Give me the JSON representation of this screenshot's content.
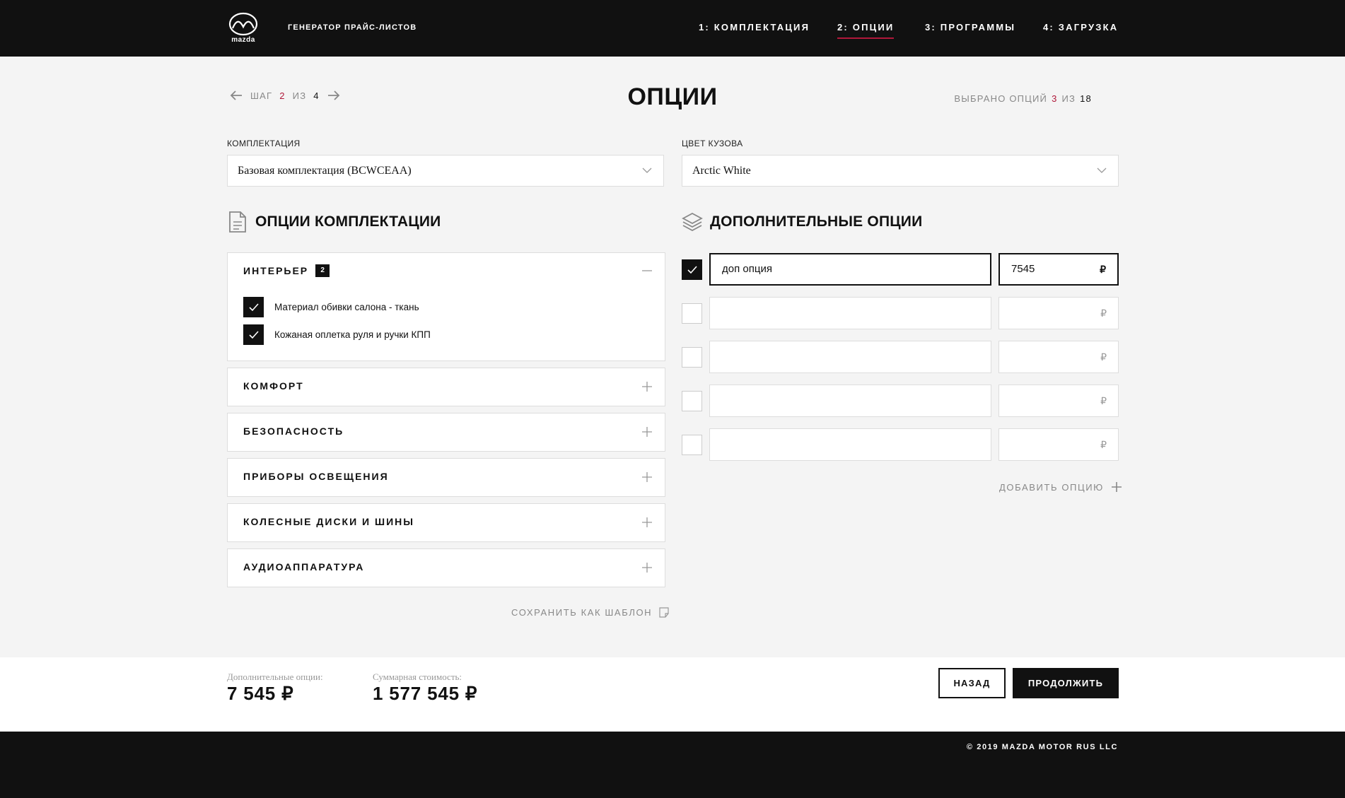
{
  "header": {
    "brand": "mazda",
    "app_title": "ГЕНЕРАТОР ПРАЙС-ЛИСТОВ",
    "nav": [
      {
        "label": "1: КОМПЛЕКТАЦИЯ"
      },
      {
        "label": "2: ОПЦИИ",
        "active": true
      },
      {
        "label": "3: ПРОГРАММЫ"
      },
      {
        "label": "4: ЗАГРУЗКА"
      }
    ]
  },
  "step": {
    "prefix": "ШАГ",
    "current": "2",
    "of": "ИЗ",
    "total": "4"
  },
  "page_title": "ОПЦИИ",
  "selected": {
    "prefix": "ВЫБРАНО ОПЦИЙ",
    "current": "3",
    "of": "ИЗ",
    "total": "18"
  },
  "trim": {
    "label": "КОМПЛЕКТАЦИЯ",
    "value": "Базовая комплектация (BCWCEAA)"
  },
  "color": {
    "label": "ЦВЕТ КУЗОВА",
    "value": "Arctic White"
  },
  "trim_options": {
    "title": "ОПЦИИ КОМПЛЕКТАЦИИ",
    "groups": [
      {
        "title": "ИНТЕРЬЕР",
        "count": "2",
        "expanded": true,
        "items": [
          "Материал обивки салона - ткань",
          "Кожаная оплетка руля и ручки КПП"
        ]
      },
      {
        "title": "КОМФОРТ"
      },
      {
        "title": "БЕЗОПАСНОСТЬ"
      },
      {
        "title": "ПРИБОРЫ ОСВЕЩЕНИЯ"
      },
      {
        "title": "КОЛЕСНЫЕ ДИСКИ И ШИНЫ"
      },
      {
        "title": "АУДИОАППАРАТУРА"
      }
    ],
    "save_template": "СОХРАНИТЬ КАК ШАБЛОН"
  },
  "extra_options": {
    "title": "ДОПОЛНИТЕЛЬНЫЕ ОПЦИИ",
    "currency": "₽",
    "rows": [
      {
        "checked": true,
        "name": "доп опция",
        "price": "7545"
      },
      {
        "checked": false,
        "name": "",
        "price": ""
      },
      {
        "checked": false,
        "name": "",
        "price": ""
      },
      {
        "checked": false,
        "name": "",
        "price": ""
      },
      {
        "checked": false,
        "name": "",
        "price": ""
      }
    ],
    "add_label": "ДОБАВИТЬ ОПЦИЮ"
  },
  "totals": {
    "extra_label": "Дополнительные опции:",
    "extra_value": "7 545 ₽",
    "sum_label": "Суммарная стоимость:",
    "sum_value": "1 577 545 ₽",
    "back_label": "НАЗАД",
    "next_label": "ПРОДОЛЖИТЬ"
  },
  "footer": {
    "copyright": "© 2019 MAZDA MOTOR RUS LLC"
  },
  "colors": {
    "accent": "#b0183a",
    "dark": "#111111",
    "background": "#f4f4f4"
  }
}
